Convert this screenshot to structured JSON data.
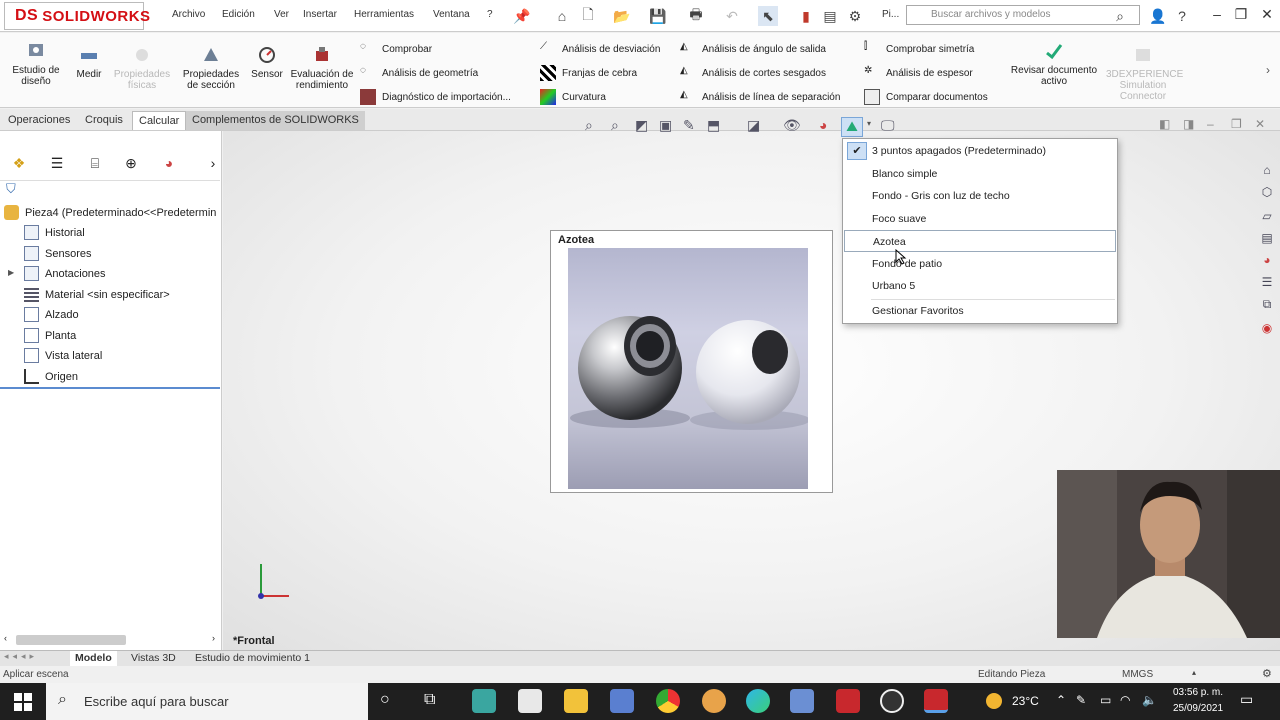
{
  "app": {
    "brand": "SOLIDWORKS",
    "brand_prefix": "DS"
  },
  "menu": [
    "Archivo",
    "Edición",
    "Ver",
    "Insertar",
    "Herramientas",
    "Ventana",
    "?"
  ],
  "toolbar": {
    "pi_label": "Pi..."
  },
  "search": {
    "placeholder": "Buscar archivos y modelos"
  },
  "ribbon": {
    "estudio_diseno": "Estudio de diseño",
    "medir": "Medir",
    "propiedades_fisicas": "Propiedades físicas",
    "propiedades_seccion": "Propiedades de sección",
    "sensor": "Sensor",
    "evaluacion_rendimiento": "Evaluación de rendimiento",
    "comprobar": "Comprobar",
    "analisis_geometria": "Análisis de geometría",
    "diagnostico_importacion": "Diagnóstico de importación...",
    "analisis_desviacion": "Análisis de desviación",
    "franjas_cebra": "Franjas de cebra",
    "curvatura": "Curvatura",
    "analisis_angulo_salida": "Análisis de ángulo de salida",
    "analisis_cortes_sesgados": "Análisis de cortes sesgados",
    "analisis_linea_separacion": "Análisis de línea de separación",
    "comprobar_simetria": "Comprobar simetría",
    "analisis_espesor": "Análisis de espesor",
    "comparar_documentos": "Comparar documentos",
    "revisar_documento": "Revisar documento activo",
    "simulation_connector": "3DEXPERIENCE Simulation Connector"
  },
  "command_tabs": [
    "Operaciones",
    "Croquis",
    "Calcular",
    "Complementos de SOLIDWORKS"
  ],
  "tree": {
    "root": "Pieza4  (Predeterminado<<Predetermin",
    "items": [
      "Historial",
      "Sensores",
      "Anotaciones",
      "Material <sin especificar>",
      "Alzado",
      "Planta",
      "Vista lateral",
      "Origen"
    ]
  },
  "viewport": {
    "view_label": "*Frontal"
  },
  "preview": {
    "title": "Azotea"
  },
  "scene_menu": {
    "items": [
      "3 puntos apagados (Predeterminado)",
      "Blanco simple",
      "Fondo - Gris con luz de techo",
      "Foco suave",
      "Azotea",
      "Fondo de patio",
      "Urbano 5"
    ],
    "checked_index": 0,
    "hover_index": 4,
    "manage": "Gestionar Favoritos"
  },
  "bottom_tabs": [
    "Modelo",
    "Vistas 3D",
    "Estudio de movimiento 1"
  ],
  "status": {
    "left": "Aplicar escena",
    "editing": "Editando Pieza",
    "units": "MMGS"
  },
  "taskbar": {
    "search": "Escribe aquí para buscar",
    "temp": "23°C",
    "time": "03:56 p. m.",
    "date": "25/09/2021"
  },
  "colors": {
    "brand_red": "#d40f14",
    "taskbar": "#1f1f1f",
    "accent_blue": "#0078d7"
  }
}
